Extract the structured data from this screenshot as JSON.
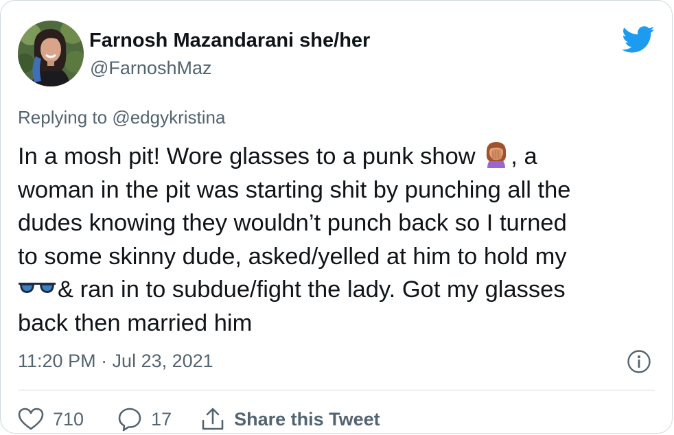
{
  "author": {
    "display_name": "Farnosh Mazandarani she/her",
    "handle": "@FarnoshMaz",
    "avatar_icon": "profile-photo"
  },
  "logo_icon": "twitter-bird-icon",
  "reply_context": {
    "prefix": "Replying to",
    "mention": "@edgykristina"
  },
  "tweet": {
    "lines": [
      {
        "before": "In a mosh pit! Wore glasses to a punk show",
        "emoji": "woman-facepalming",
        "after": ", a"
      },
      {
        "text": "woman in the pit was starting shit by punching all the"
      },
      {
        "text": "dudes knowing they wouldn’t punch back so I turned"
      },
      {
        "text": "to some skinny dude, asked/yelled at him to hold my"
      },
      {
        "emoji": "sunglasses",
        "after": "& ran in to subdue/fight the lady. Got my glasses"
      },
      {
        "text": "back then married him"
      }
    ]
  },
  "timestamp": "11:20 PM · Jul 23, 2021",
  "actions": {
    "like_count": "710",
    "reply_count": "17",
    "share_label": "Share this Tweet"
  },
  "colors": {
    "brand_blue": "#1d9bf0",
    "text_primary": "#0f1419",
    "text_secondary": "#536471",
    "border": "#cfd9de"
  }
}
